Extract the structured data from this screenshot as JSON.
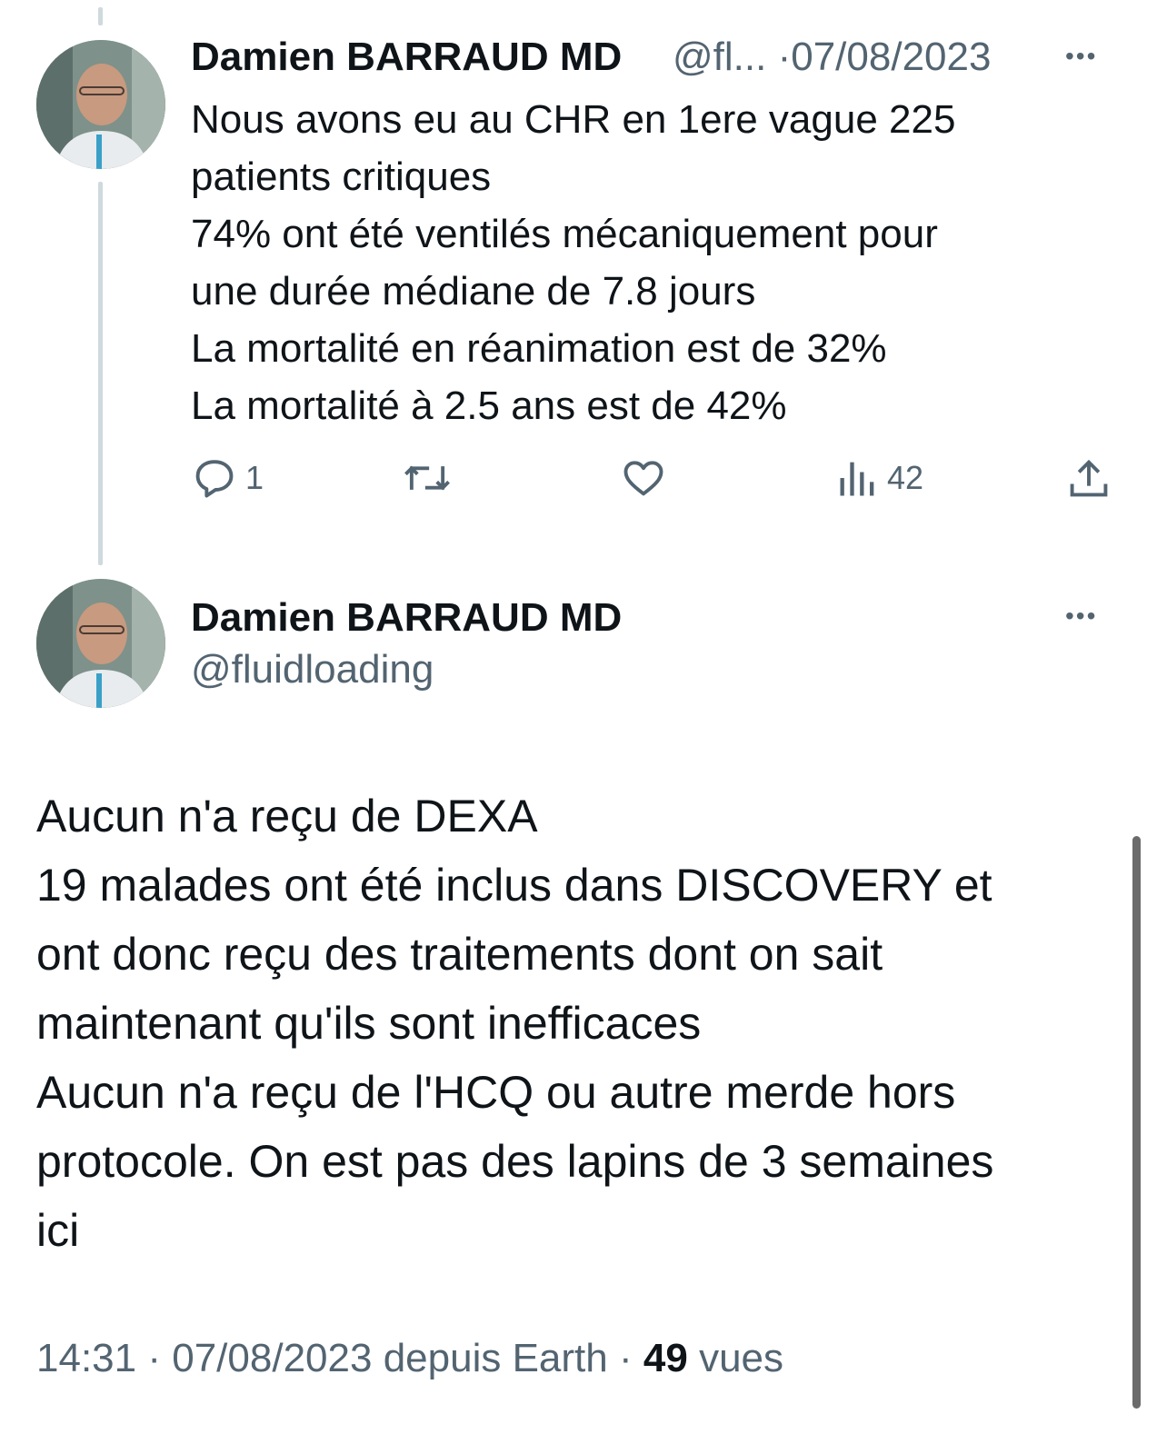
{
  "tweet1": {
    "author_name": "Damien BARRAUD MD",
    "handle_truncated": "@fl...",
    "separator": "·",
    "date": "07/08/2023",
    "more_label": "•••",
    "lines": [
      "Nous avons eu au CHR en 1ere vague 225",
      "patients critiques",
      "74% ont été ventilés mécaniquement pour",
      "une durée médiane de 7.8 jours",
      "La mortalité en réanimation est de 32%",
      "La mortalité à 2.5 ans est de 42%"
    ],
    "actions": {
      "reply_count": "1",
      "retweet_count": "",
      "like_count": "",
      "views_count": "42"
    }
  },
  "tweet2": {
    "author_name": "Damien BARRAUD MD",
    "handle": "@fluidloading",
    "more_label": "•••",
    "lines": [
      "Aucun n'a reçu de DEXA",
      "19 malades ont été inclus dans DISCOVERY et",
      "ont donc reçu des traitements dont on sait",
      "maintenant qu'ils sont inefficaces",
      "Aucun n'a reçu de l'HCQ ou autre merde hors",
      "protocole. On est pas des lapins de 3 semaines",
      "ici"
    ],
    "footer": {
      "time": "14:31",
      "sep1": "·",
      "date": "07/08/2023",
      "source": "depuis Earth",
      "sep2": "·",
      "views_count": "49",
      "views_label": "vues"
    }
  },
  "icons": {
    "reply": "reply-icon",
    "retweet": "retweet-icon",
    "like": "heart-icon",
    "views": "views-icon",
    "share": "share-icon"
  },
  "colors": {
    "text": "#0f1419",
    "muted": "#536471",
    "thread_line": "#cfd9de"
  }
}
